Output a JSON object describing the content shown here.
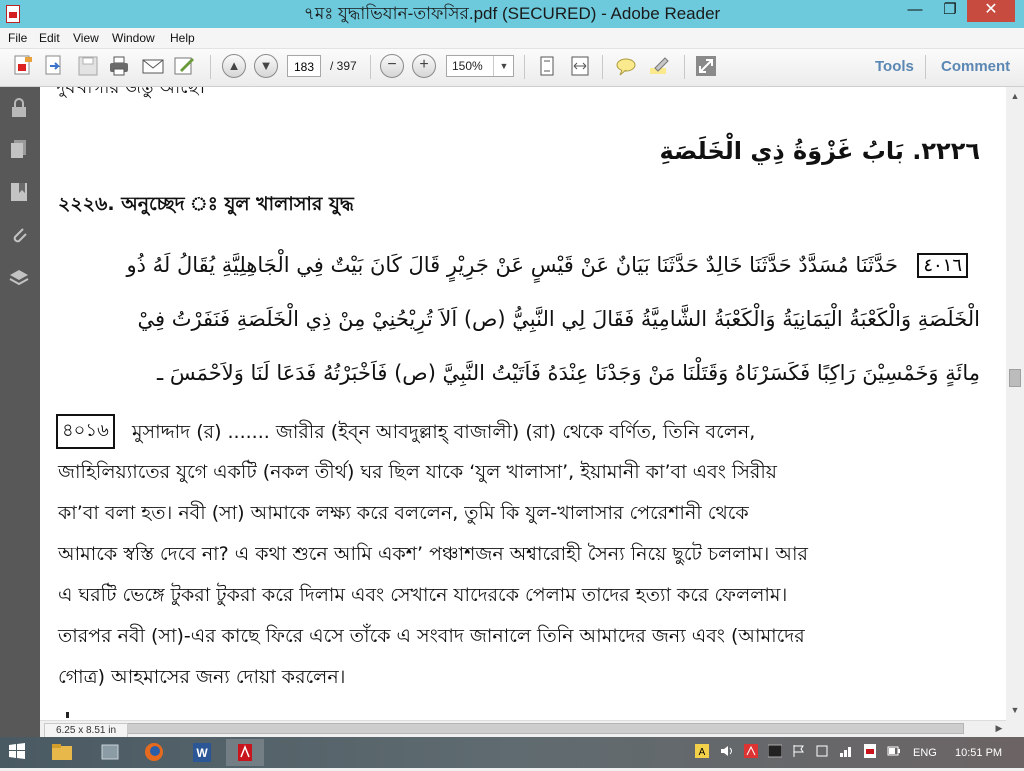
{
  "window": {
    "title": "৭মঃ যুদ্ধাভিযান-তাফসির.pdf (SECURED) - Adobe Reader",
    "controls": {
      "minimize": "—",
      "maximize": "❐",
      "close": "✕"
    }
  },
  "menu": [
    "File",
    "Edit",
    "View",
    "Window",
    "Help"
  ],
  "toolbar": {
    "icons": [
      "create-pdf-icon",
      "open-file-icon",
      "save-icon",
      "print-icon",
      "email-icon",
      "sign-icon",
      "previous-page-icon",
      "next-page-icon",
      "zoom-out-icon",
      "zoom-in-icon",
      "fit-page-icon",
      "fit-width-icon",
      "comment-icon",
      "highlight-icon",
      "fullscreen-icon"
    ],
    "current_page": "183",
    "total_pages": "/ 397",
    "zoom": "150%",
    "tools_label": "Tools",
    "comment_label": "Comment",
    "accent_color": "#5a87b3"
  },
  "nav_pane": [
    "lock-icon",
    "pages-icon",
    "bookmarks-icon",
    "attachments-icon",
    "layers-icon"
  ],
  "document": {
    "top_cut_text": "দুষখাগার জন্তু আছে।",
    "arabic_heading": "٢٢٢٦. بَابُ غَزْوَةُ ذِي الْخَلَصَةِ",
    "bengali_heading": "২২২৬. অনুচ্ছেদ ঃ যুল খালাসার যুদ্ধ",
    "arabic_number": "٤٠١٦",
    "arabic_lines": [
      "حَدَّثَنَا مُسَدَّدٌ حَدَّثَنَا خَالِدٌ حَدَّثَنَا بَيَانٌ عَنْ قَيْسٍ عَنْ جَرِيْرٍ قَالَ كَانَ بَيْتٌ فِي الْجَاهِلِيَّةِ يُقَالُ لَهُ ذُو",
      "الْخَلَصَةِ وَالْكَعْبَةُ الْيَمَانِيَةُ وَالْكَعْبَةُ الشَّامِيَّةُ فَقَالَ لِي النَّبِيُّ (ص) اَلاَ تُرِيْحُنِيْ مِنْ ذِي الْخَلَصَةِ فَنَفَرْتُ فِيْ",
      "مِائَةٍ وَخَمْسِيْنَ رَاكِبًا فَكَسَرْنَاهُ وَقَتَلْنَا مَنْ وَجَدْنَا عِنْدَهُ فَاَتَيْتُ النَّبِيَّ (ص) فَاَخْبَرْتُهُ فَدَعَا لَنَا وَلاَحْمَسَ ـ"
    ],
    "bengali_number": "৪০১৬",
    "bengali_lines": [
      "মুসাদ্দাদ (র) ....... জারীর (ইব্‌ন আবদুল্লাহ্‌ বাজালী) (রা) থেকে বর্ণিত, তিনি বলেন,",
      "জাহিলিয়্যাতের যুগে একটি (নকল তীর্থ) ঘর ছিল যাকে ‘যুল খালাসা’, ইয়ামানী কা’বা এবং সিরীয়",
      "কা’বা বলা হত। নবী (সা) আমাকে লক্ষ্য করে বললেন, তুমি কি যুল-খালাসার পেরেশানী থেকে",
      "আমাকে স্বস্তি দেবে না? এ কথা শুনে আমি একশ’ পঞ্চাশজন অশ্বারোহী সৈন্য নিয়ে ছুটে চললাম। আর",
      "এ ঘরটি ভেঙ্গে টুকরা টুকরা করে দিলাম এবং সেখানে যাদেরকে পেলাম তাদের হত্যা করে ফেললাম।",
      "তারপর নবী (সা)-এর কাছে ফিরে এসে তাঁকে এ সংবাদ জানালে তিনি আমাদের জন্য এবং (আমাদের",
      "গোত্র) আহমাসের জন্য দোয়া করলেন।"
    ]
  },
  "status": {
    "page_size": "6.25 x 8.51 in"
  },
  "scroll": {
    "position": 0.45
  },
  "taskbar": {
    "apps": [
      "file-explorer-icon",
      "app-icon",
      "firefox-icon",
      "word-icon",
      "adobe-reader-icon"
    ],
    "tray_icons": [
      "font-icon",
      "volume-icon",
      "app-icon",
      "terminal-icon",
      "flag-icon",
      "app-icon",
      "network-icon",
      "pdf-icon",
      "battery-icon"
    ],
    "language": "ENG",
    "time": "10:51 PM"
  }
}
